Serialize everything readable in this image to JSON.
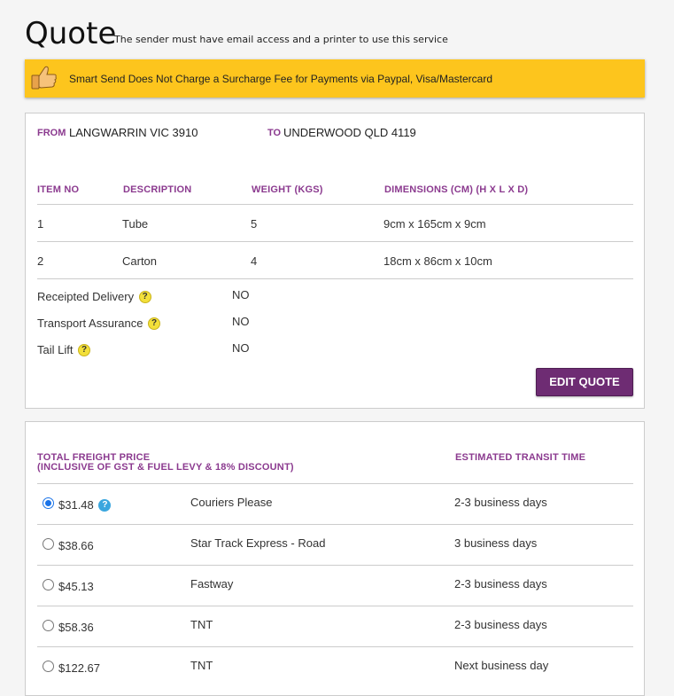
{
  "header": {
    "title": "Quote",
    "subtitle": "The sender must have email access and a printer to use this service"
  },
  "banner": {
    "icon": "thumbs-up-icon",
    "text": "Smart Send Does Not Charge a Surcharge Fee for Payments via Paypal, Visa/Mastercard",
    "color": "#fdc51d"
  },
  "route": {
    "from_label": "FROM",
    "from_value": "LANGWARRIN VIC 3910",
    "to_label": "TO",
    "to_value": "UNDERWOOD QLD 4119"
  },
  "items": {
    "headers": [
      "ITEM NO",
      "DESCRIPTION",
      "WEIGHT (KGS)",
      "DIMENSIONS (CM) (H X L X D)"
    ],
    "rows": [
      [
        "1",
        "Tube",
        "5",
        "9cm x  165cm x  9cm"
      ],
      [
        "2",
        "Carton",
        "4",
        "18cm x  86cm x  10cm"
      ]
    ]
  },
  "options": [
    {
      "label": "Receipted Delivery",
      "value": "NO"
    },
    {
      "label": "Transport Assurance",
      "value": "NO"
    },
    {
      "label": "Tail Lift",
      "value": "NO"
    }
  ],
  "help_glyph": "?",
  "edit_button": "EDIT QUOTE",
  "freight": {
    "price_header_line1": "TOTAL FREIGHT PRICE",
    "price_header_line2": "(INCLUSIVE OF GST & FUEL LEVY & 18% DISCOUNT)",
    "transit_header": "ESTIMATED TRANSIT TIME",
    "rows": [
      {
        "price": "$31.48",
        "carrier": "Couriers Please",
        "transit": "2-3 business days",
        "selected": true
      },
      {
        "price": "$38.66",
        "carrier": "Star Track Express - Road",
        "transit": "3 business days",
        "selected": false
      },
      {
        "price": "$45.13",
        "carrier": "Fastway",
        "transit": "2-3 business days",
        "selected": false
      },
      {
        "price": "$58.36",
        "carrier": "TNT",
        "transit": "2-3 business days",
        "selected": false
      },
      {
        "price": "$122.67",
        "carrier": "TNT",
        "transit": "Next business day",
        "selected": false
      }
    ]
  },
  "colors": {
    "accent": "#8b3a8f",
    "button": "#6e2c73",
    "banner": "#fdc51d"
  }
}
